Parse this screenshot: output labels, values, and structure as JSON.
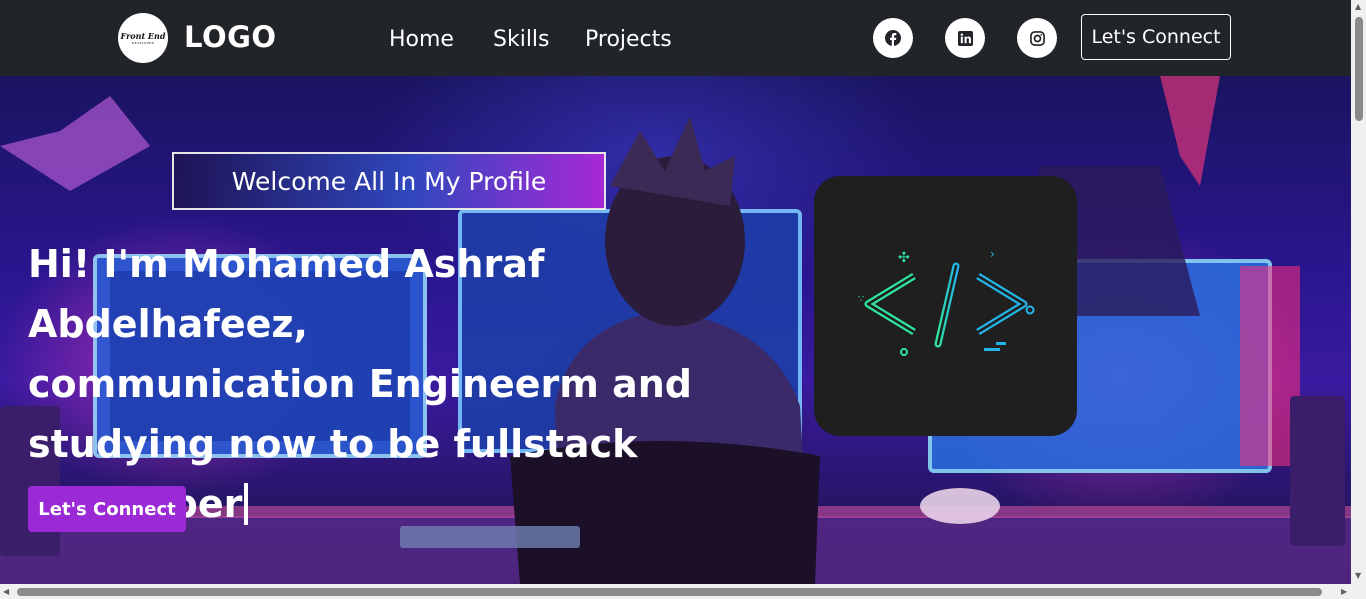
{
  "nav": {
    "logo_badge_text": "Front End",
    "logo_badge_sub": "DEVELOPER",
    "brand": "LOGO",
    "links": [
      "Home",
      "Skills",
      "Projects"
    ],
    "social_icons": [
      "facebook-icon",
      "linkedin-icon",
      "instagram-icon"
    ],
    "connect_label": "Let's Connect"
  },
  "hero": {
    "welcome": "Welcome All In My Profile",
    "headline_lines": [
      "Hi! I'm Mohamed Ashraf Abdelhafeez,",
      "communication Engineerm and",
      "studying now to be fullstack",
      "developer"
    ],
    "connect_label": "Let's Connect",
    "code_symbol": "</>"
  },
  "colors": {
    "navbar": "#212529",
    "accent_purple": "#9b2ad6",
    "code_card": "#1f1f20",
    "code_green": "#2ee59d",
    "code_cyan": "#23b5e8"
  }
}
